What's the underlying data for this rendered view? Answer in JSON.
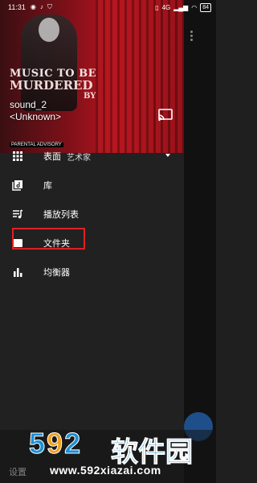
{
  "status_bar": {
    "time": "11:31",
    "left_icons": [
      "notification-icon",
      "tiktok-icon",
      "shield-icon"
    ],
    "network_label": "4G",
    "battery": "84"
  },
  "header": {
    "album_art": {
      "line1": "MUSIC TO BE",
      "line2": "MURDERED",
      "line3": "BY",
      "advisory": "PARENTAL ADVISORY"
    },
    "track_title": "sound_2",
    "track_artist": "<Unknown>",
    "cast_icon": "cast-icon"
  },
  "menu": {
    "items": [
      {
        "label": "表面",
        "sub": "艺术家",
        "icon": "grid-icon",
        "has_dropdown": true
      },
      {
        "label": "库",
        "icon": "library-icon"
      },
      {
        "label": "播放列表",
        "icon": "playlist-icon"
      },
      {
        "label": "文件夹",
        "icon": "folder-icon"
      },
      {
        "label": "均衡器",
        "icon": "equalizer-icon"
      }
    ]
  },
  "footer": {
    "settings_label": "设置"
  },
  "watermark": {
    "logo_digits_a": "5",
    "logo_digits_b": "9",
    "logo_digits_c": "2",
    "logo_cn": "软件园",
    "url": "www.592xiazai.com"
  },
  "colors": {
    "drawer_bg": "#212121",
    "highlight": "#e02020",
    "accent_blue": "#1a8fd6"
  }
}
